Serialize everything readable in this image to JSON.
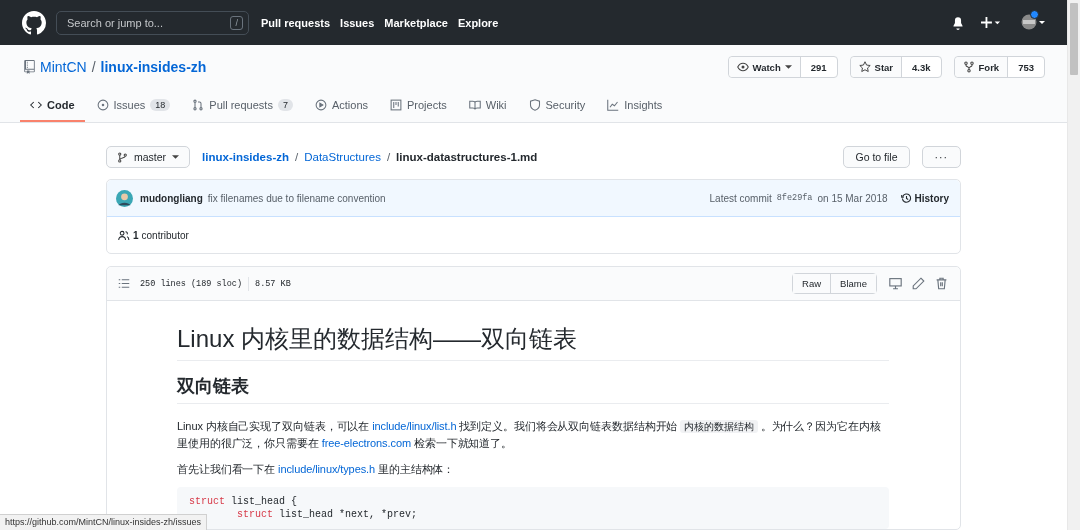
{
  "header": {
    "search": {
      "placeholder": "Search or jump to...",
      "key": "/"
    },
    "nav": [
      "Pull requests",
      "Issues",
      "Marketplace",
      "Explore"
    ],
    "notification_dot": true
  },
  "repo": {
    "owner": "MintCN",
    "separator": "/",
    "name": "linux-insides-zh",
    "actions": [
      {
        "kind": "watch",
        "label": "Watch",
        "count": "291"
      },
      {
        "kind": "star",
        "label": "Star",
        "count": "4.3k"
      },
      {
        "kind": "fork",
        "label": "Fork",
        "count": "753"
      }
    ],
    "tabs": [
      {
        "kind": "code",
        "label": "Code",
        "selected": true
      },
      {
        "kind": "issues",
        "label": "Issues",
        "count": "18",
        "selected": false
      },
      {
        "kind": "pulls",
        "label": "Pull requests",
        "count": "7",
        "selected": false
      },
      {
        "kind": "actions",
        "label": "Actions",
        "selected": false
      },
      {
        "kind": "projects",
        "label": "Projects",
        "selected": false
      },
      {
        "kind": "wiki",
        "label": "Wiki",
        "selected": false
      },
      {
        "kind": "security",
        "label": "Security",
        "selected": false
      },
      {
        "kind": "insights",
        "label": "Insights",
        "selected": false
      }
    ]
  },
  "breadcrumb": {
    "branch": "master",
    "path": [
      "linux-insides-zh",
      "/",
      "DataStructures",
      "/"
    ],
    "file": "linux-datastructures-1.md",
    "go_to_file": "Go to file",
    "more": "···"
  },
  "commit": {
    "author": "mudongliang",
    "message": "fix filenames due to filename convention",
    "latest_label": "Latest commit",
    "sha": "8fe29fa",
    "date": "on 15 Mar 2018",
    "history": "History"
  },
  "contributors": {
    "count": "1",
    "label": "contributor"
  },
  "file": {
    "lines": "250 lines (189 sloc)",
    "size": "8.57 KB",
    "buttons": [
      "Raw",
      "Blame"
    ]
  },
  "markdown": {
    "h1": "Linux 内核里的数据结构——双向链表",
    "h2": "双向链表",
    "paragraphs": [
      [
        {
          "kind": "text",
          "text": "Linux 内核自己实现了双向链表，可以在 "
        },
        {
          "kind": "link",
          "text": "include/linux/list.h"
        },
        {
          "kind": "text",
          "text": " 找到定义。我们将会从双向链表数据结构开始 "
        },
        {
          "kind": "code",
          "text": "内核的数据结构"
        },
        {
          "kind": "text",
          "text": " 。为什么？因为它在内核里使用的很广泛，你只需要在 "
        },
        {
          "kind": "link",
          "text": "free-electrons.com"
        },
        {
          "kind": "text",
          "text": " 检索一下就知道了。"
        }
      ],
      [
        {
          "kind": "text",
          "text": "首先让我们看一下在 "
        },
        {
          "kind": "link",
          "text": "include/linux/types.h"
        },
        {
          "kind": "text",
          "text": " 里的主结构体："
        }
      ]
    ],
    "code": [
      {
        "parts": [
          {
            "kind": "keyword",
            "text": "struct"
          },
          {
            "kind": "plain",
            "text": " list_head {"
          }
        ]
      },
      {
        "indent": true,
        "parts": [
          {
            "kind": "keyword",
            "text": "struct"
          },
          {
            "kind": "plain",
            "text": " list_head *next, *prev;"
          }
        ]
      }
    ]
  },
  "status_bar": "https://github.com/MintCN/linux-insides-zh/issues"
}
